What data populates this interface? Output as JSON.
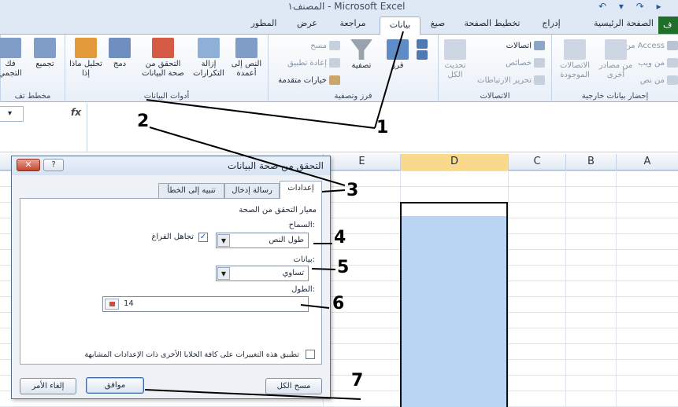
{
  "window": {
    "title": "المصنف١ - Microsoft Excel"
  },
  "ribbon": {
    "file_tab": "ف",
    "tabs": [
      "الصفحة الرئيسية",
      "إدراج",
      "تخطيط الصفحة",
      "صيغ",
      "بيانات",
      "مراجعة",
      "عرض",
      "المطور"
    ],
    "active_tab": "بيانات",
    "groups": {
      "external_data": {
        "label": "إحضار بيانات خارجية",
        "access": "من Access",
        "web": "من ويب",
        "text": "من نص",
        "other_sources": "من مصادر أخرى",
        "existing": "الاتصالات الموجودة"
      },
      "connections": {
        "label": "الاتصالات",
        "refresh_all": "تحديث الكل",
        "connections": "اتصالات",
        "properties": "خصائص",
        "edit_links": "تحرير الارتباطات"
      },
      "sort_filter": {
        "label": "فرز وتصفية",
        "sort": "فرز",
        "filter": "تصفية",
        "clear": "مسح",
        "reapply": "إعادة تطبيق",
        "advanced": "خيارات متقدمة"
      },
      "data_tools": {
        "label": "أدوات البيانات",
        "text_to_columns": "النص إلى أعمدة",
        "remove_duplicates": "إزالة التكرارات",
        "data_validation": "التحقق من صحة البيانات",
        "consolidate": "دمج",
        "what_if": "تحليل ماذا إذا"
      },
      "outline": {
        "label": "مخطط تف",
        "group": "تجميع",
        "ungroup": "فك التجمي"
      }
    }
  },
  "formula_bar": {
    "fx": "fx"
  },
  "sheet": {
    "columns": [
      "A",
      "B",
      "C",
      "D",
      "E"
    ],
    "selected_column": "D"
  },
  "dialog": {
    "title": "التحقق من صحة البيانات",
    "close": "✕",
    "help": "?",
    "tabs": [
      "إعدادات",
      "رسالة إدخال",
      "تنبيه إلى الخطأ"
    ],
    "active_tab": "إعدادات",
    "criteria_heading": "معيار التحقق من الصحة",
    "allow_label": "السماح:",
    "allow_value": "طول النص",
    "ignore_blank_label": "تجاهل الفراغ",
    "ignore_blank_checked": true,
    "data_label": "بيانات:",
    "data_value": "تساوي",
    "length_label": "الطول:",
    "length_value": "14",
    "apply_all_label": "تطبيق هذه التغييرات على كافة الخلايا الأخرى ذات الإعدادات المشابهة",
    "apply_all_checked": false,
    "clear_all": "مسح الكل",
    "ok": "موافق",
    "cancel": "إلغاء الأمر"
  },
  "annotations": [
    "1",
    "2",
    "3",
    "4",
    "5",
    "6",
    "7"
  ]
}
